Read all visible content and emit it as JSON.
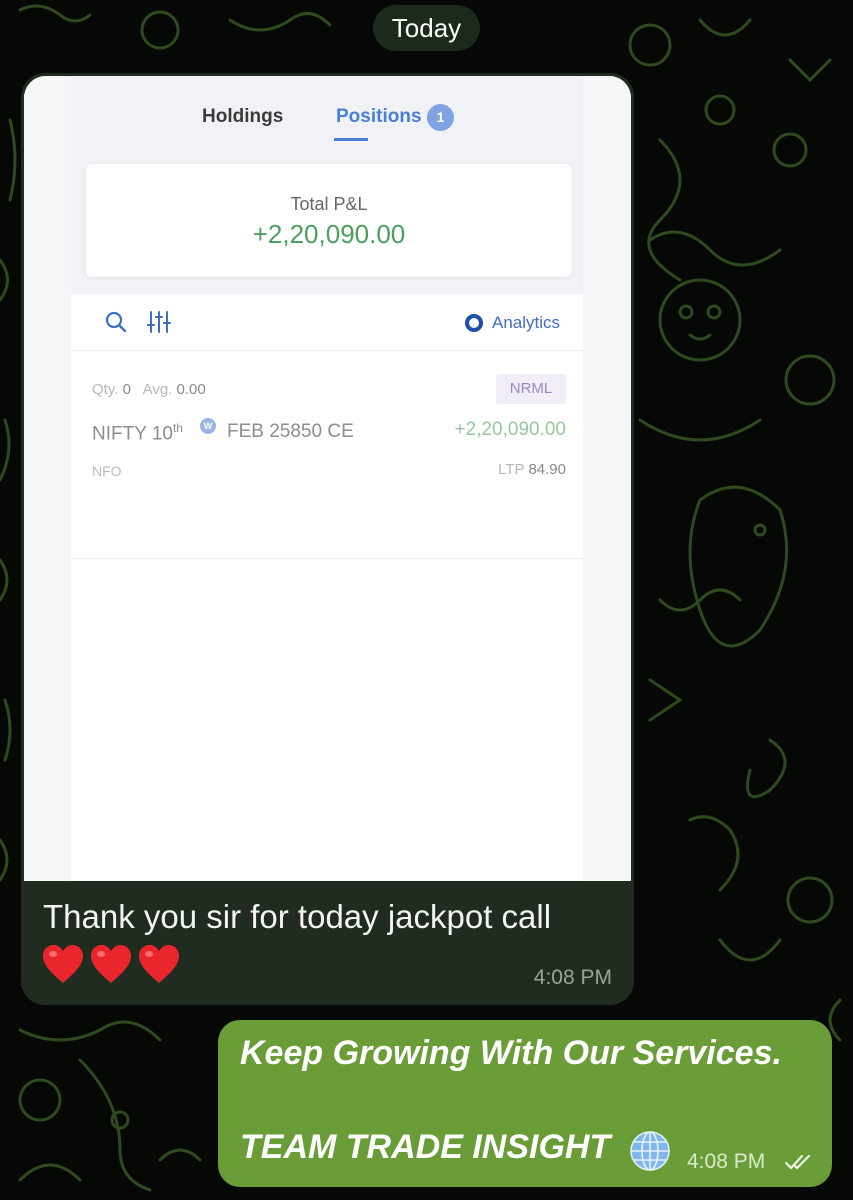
{
  "chat": {
    "date_label": "Today"
  },
  "incoming": {
    "screenshot": {
      "tabs": [
        {
          "label": "Holdings"
        },
        {
          "label": "Positions",
          "badge": "1"
        }
      ],
      "summary": {
        "label": "Total P&L",
        "value": "+2,20,090.00"
      },
      "toolbar": {
        "search_icon": "search-icon",
        "filter_icon": "sliders-icon",
        "analytics_label": "Analytics"
      },
      "position": {
        "qty_label": "Qty.",
        "qty": "0",
        "avg_label": "Avg.",
        "avg": "0.00",
        "product": "NRML",
        "instrument": "NIFTY 10",
        "instrument_sup": "th",
        "weekly_badge": "W",
        "instrument_rest": "FEB 25850 CE",
        "pnl": "+2,20,090.00",
        "exchange": "NFO",
        "ltp_label": "LTP",
        "ltp": "84.90"
      }
    },
    "text": "Thank you sir for today jackpot call",
    "emoji": [
      "heart",
      "heart",
      "heart"
    ],
    "time": "4:08 PM"
  },
  "outgoing": {
    "line1": "Keep Growing With Our Services.",
    "line2": "TEAM TRADE INSIGHT",
    "emoji": "globe",
    "time": "4:08 PM",
    "status": "read-ticks"
  },
  "colors": {
    "incoming_bubble": "#1f2c1f",
    "outgoing_bubble": "#6a9d37",
    "profit_green": "#4aa05c",
    "active_tab": "#4a7fd4"
  }
}
